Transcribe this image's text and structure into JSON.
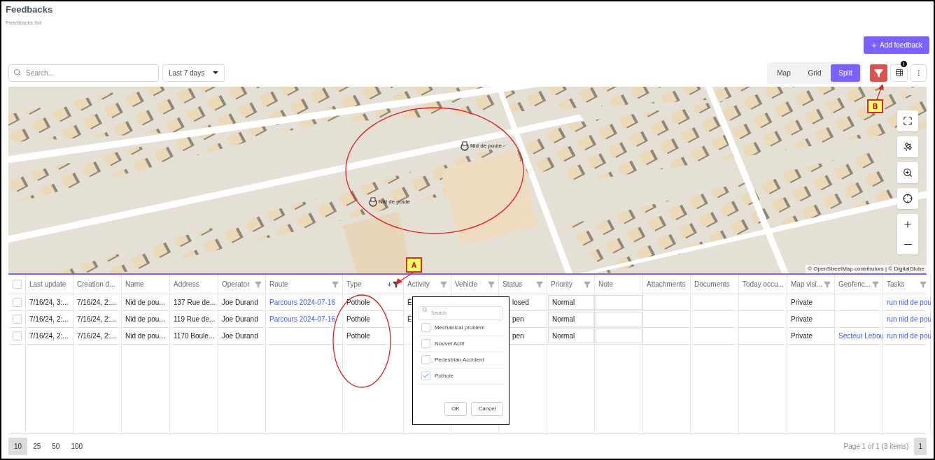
{
  "header": {
    "title": "Feedbacks",
    "subtitle": "Feedbacks list"
  },
  "add_button": {
    "label": "Add feedback"
  },
  "search": {
    "placeholder": "Search..."
  },
  "period_dropdown": {
    "value": "Last 7 days"
  },
  "view_toggle": [
    {
      "label": "Map",
      "selected": false
    },
    {
      "label": "Grid",
      "selected": false
    },
    {
      "label": "Split",
      "selected": true
    }
  ],
  "filter_button": {
    "active": true
  },
  "map": {
    "markers": [
      {
        "label": "Nid de poule"
      },
      {
        "label": "Nid de poule"
      }
    ],
    "attribution": "© OpenStreetMap contributors | © DigitalGlobe"
  },
  "callouts": [
    {
      "label": "A"
    },
    {
      "label": "B"
    }
  ],
  "table": {
    "select_all": {
      "checked": false
    },
    "columns": [
      {
        "label": "Last update",
        "filter": false,
        "sorted": false,
        "kind": "plain"
      },
      {
        "label": "Creation d...",
        "filter": false,
        "sorted": false,
        "kind": "plain"
      },
      {
        "label": "Name",
        "filter": false,
        "sorted": false,
        "kind": "plain"
      },
      {
        "label": "Address",
        "filter": false,
        "sorted": false,
        "kind": "plain"
      },
      {
        "label": "Operator",
        "filter": true,
        "sorted": false,
        "kind": "plain"
      },
      {
        "label": "Route",
        "filter": true,
        "sorted": false,
        "kind": "plain"
      },
      {
        "label": "Type",
        "filter": true,
        "sorted": true,
        "kind": "plain"
      },
      {
        "label": "Activity",
        "filter": true,
        "sorted": false,
        "kind": "plain"
      },
      {
        "label": "Vehicle",
        "filter": true,
        "sorted": false,
        "kind": "plain"
      },
      {
        "label": "Status",
        "filter": true,
        "sorted": false,
        "kind": "plain"
      },
      {
        "label": "Priority",
        "filter": true,
        "sorted": false,
        "kind": "editable"
      },
      {
        "label": "Note",
        "filter": false,
        "sorted": false,
        "kind": "editable"
      },
      {
        "label": "Attachments",
        "filter": false,
        "sorted": false,
        "kind": "plain"
      },
      {
        "label": "Documents",
        "filter": false,
        "sorted": false,
        "kind": "plain"
      },
      {
        "label": "Today occu...",
        "filter": false,
        "sorted": false,
        "kind": "plain"
      },
      {
        "label": "Map visi...",
        "filter": true,
        "sorted": false,
        "kind": "plain"
      },
      {
        "label": "Geofenc...",
        "filter": true,
        "sorted": false,
        "kind": "plain"
      },
      {
        "label": "Tasks",
        "filter": true,
        "sorted": false,
        "kind": "plain"
      }
    ],
    "rows": [
      {
        "checked": false,
        "cells": [
          {
            "text": "7/16/24, 3:...",
            "kind": "text"
          },
          {
            "text": "7/16/24, 2:...",
            "kind": "text"
          },
          {
            "text": "Nid de pou...",
            "kind": "text"
          },
          {
            "text": "137 Rue de...",
            "kind": "text"
          },
          {
            "text": "Joe Durand",
            "kind": "text"
          },
          {
            "text": "Parcours 2024-07-16",
            "kind": "link"
          },
          {
            "text": "Pothole",
            "kind": "text"
          },
          {
            "text": "É",
            "kind": "text"
          },
          null,
          {
            "text": "losed",
            "kind": "text"
          },
          {
            "text": "Normal",
            "kind": "text"
          },
          null,
          null,
          null,
          null,
          {
            "text": "Private",
            "kind": "text"
          },
          null,
          {
            "text": "run nid de pou",
            "kind": "link"
          }
        ]
      },
      {
        "checked": false,
        "cells": [
          {
            "text": "7/16/24, 2:...",
            "kind": "text"
          },
          {
            "text": "7/16/24, 2:...",
            "kind": "text"
          },
          {
            "text": "Nid de pou...",
            "kind": "text"
          },
          {
            "text": "119 Rue de...",
            "kind": "text"
          },
          {
            "text": "Joe Durand",
            "kind": "text"
          },
          {
            "text": "Parcours 2024-07-16",
            "kind": "link"
          },
          {
            "text": "Pothole",
            "kind": "text"
          },
          {
            "text": "É",
            "kind": "text"
          },
          null,
          {
            "text": "pen",
            "kind": "text"
          },
          {
            "text": "Normal",
            "kind": "text"
          },
          null,
          null,
          null,
          null,
          {
            "text": "Private",
            "kind": "text"
          },
          null,
          {
            "text": "run nid de pou",
            "kind": "link"
          }
        ]
      },
      {
        "checked": false,
        "cells": [
          {
            "text": "7/16/24, 2:...",
            "kind": "text"
          },
          {
            "text": "7/16/24, 2:...",
            "kind": "text"
          },
          {
            "text": "Nid de pou...",
            "kind": "text"
          },
          {
            "text": "1170 Boule...",
            "kind": "text"
          },
          {
            "text": "Joe Durand",
            "kind": "text"
          },
          null,
          {
            "text": "Pothole",
            "kind": "text"
          },
          null,
          null,
          {
            "text": "pen",
            "kind": "text"
          },
          {
            "text": "Normal",
            "kind": "text"
          },
          null,
          null,
          null,
          null,
          {
            "text": "Private",
            "kind": "text"
          },
          {
            "text": "Secteur Lebou",
            "kind": "link"
          },
          {
            "text": "run nid de pou",
            "kind": "link"
          }
        ]
      }
    ]
  },
  "filter_popup": {
    "placeholder": "Search",
    "options": [
      {
        "label": "Mechanical problem",
        "checked": false
      },
      {
        "label": "Nouvel Actif",
        "checked": false
      },
      {
        "label": "Pedestrian Accident",
        "checked": false
      },
      {
        "label": "Pothole",
        "checked": true
      }
    ],
    "buttons": [
      "OK",
      "Cancel"
    ]
  },
  "pagination": {
    "sizes": [
      {
        "label": "10",
        "selected": true
      },
      {
        "label": "25",
        "selected": false
      },
      {
        "label": "50",
        "selected": false
      },
      {
        "label": "100",
        "selected": false
      }
    ],
    "summary": "Page 1 of 1 (3 items)",
    "pages": [
      {
        "label": "1",
        "selected": true
      }
    ]
  }
}
